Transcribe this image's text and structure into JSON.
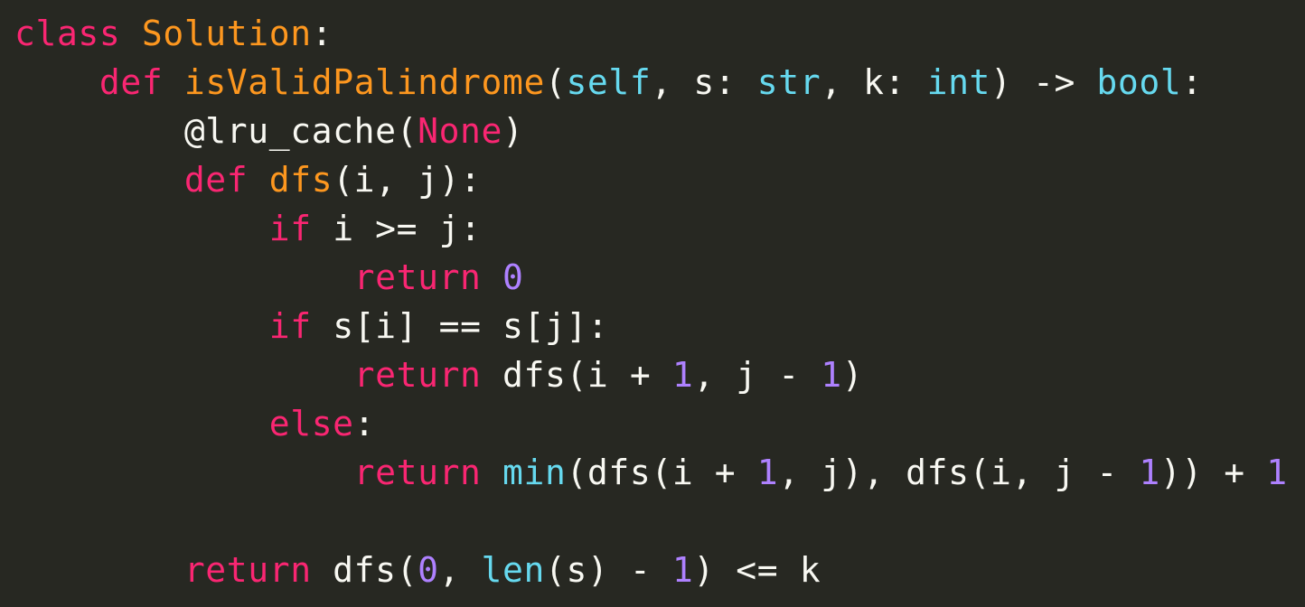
{
  "colors": {
    "background": "#272822",
    "keyword": "#f92672",
    "name": "#fd971f",
    "builtin": "#66d9ef",
    "number": "#ae81ff",
    "plain": "#f8f8f2"
  },
  "code": {
    "language": "python",
    "lines": [
      [
        {
          "t": "class",
          "c": "keyword"
        },
        {
          "t": " ",
          "c": "plain"
        },
        {
          "t": "Solution",
          "c": "name"
        },
        {
          "t": ":",
          "c": "plain"
        }
      ],
      [
        {
          "t": "    ",
          "c": "plain"
        },
        {
          "t": "def",
          "c": "keyword"
        },
        {
          "t": " ",
          "c": "plain"
        },
        {
          "t": "isValidPalindrome",
          "c": "name"
        },
        {
          "t": "(",
          "c": "plain"
        },
        {
          "t": "self",
          "c": "builtin"
        },
        {
          "t": ", s: ",
          "c": "plain"
        },
        {
          "t": "str",
          "c": "builtin"
        },
        {
          "t": ", k: ",
          "c": "plain"
        },
        {
          "t": "int",
          "c": "builtin"
        },
        {
          "t": ") -> ",
          "c": "plain"
        },
        {
          "t": "bool",
          "c": "builtin"
        },
        {
          "t": ":",
          "c": "plain"
        }
      ],
      [
        {
          "t": "        ",
          "c": "plain"
        },
        {
          "t": "@lru_cache(",
          "c": "plain"
        },
        {
          "t": "None",
          "c": "keyword"
        },
        {
          "t": ")",
          "c": "plain"
        }
      ],
      [
        {
          "t": "        ",
          "c": "plain"
        },
        {
          "t": "def",
          "c": "keyword"
        },
        {
          "t": " ",
          "c": "plain"
        },
        {
          "t": "dfs",
          "c": "name"
        },
        {
          "t": "(i, j):",
          "c": "plain"
        }
      ],
      [
        {
          "t": "            ",
          "c": "plain"
        },
        {
          "t": "if",
          "c": "keyword"
        },
        {
          "t": " i >= j:",
          "c": "plain"
        }
      ],
      [
        {
          "t": "                ",
          "c": "plain"
        },
        {
          "t": "return",
          "c": "keyword"
        },
        {
          "t": " ",
          "c": "plain"
        },
        {
          "t": "0",
          "c": "number"
        }
      ],
      [
        {
          "t": "            ",
          "c": "plain"
        },
        {
          "t": "if",
          "c": "keyword"
        },
        {
          "t": " s[i] == s[j]:",
          "c": "plain"
        }
      ],
      [
        {
          "t": "                ",
          "c": "plain"
        },
        {
          "t": "return",
          "c": "keyword"
        },
        {
          "t": " dfs(i + ",
          "c": "plain"
        },
        {
          "t": "1",
          "c": "number"
        },
        {
          "t": ", j - ",
          "c": "plain"
        },
        {
          "t": "1",
          "c": "number"
        },
        {
          "t": ")",
          "c": "plain"
        }
      ],
      [
        {
          "t": "            ",
          "c": "plain"
        },
        {
          "t": "else",
          "c": "keyword"
        },
        {
          "t": ":",
          "c": "plain"
        }
      ],
      [
        {
          "t": "                ",
          "c": "plain"
        },
        {
          "t": "return",
          "c": "keyword"
        },
        {
          "t": " ",
          "c": "plain"
        },
        {
          "t": "min",
          "c": "builtin"
        },
        {
          "t": "(dfs(i + ",
          "c": "plain"
        },
        {
          "t": "1",
          "c": "number"
        },
        {
          "t": ", j), dfs(i, j - ",
          "c": "plain"
        },
        {
          "t": "1",
          "c": "number"
        },
        {
          "t": ")) + ",
          "c": "plain"
        },
        {
          "t": "1",
          "c": "number"
        }
      ],
      [],
      [
        {
          "t": "        ",
          "c": "plain"
        },
        {
          "t": "return",
          "c": "keyword"
        },
        {
          "t": " dfs(",
          "c": "plain"
        },
        {
          "t": "0",
          "c": "number"
        },
        {
          "t": ", ",
          "c": "plain"
        },
        {
          "t": "len",
          "c": "builtin"
        },
        {
          "t": "(s) - ",
          "c": "plain"
        },
        {
          "t": "1",
          "c": "number"
        },
        {
          "t": ") <= k",
          "c": "plain"
        }
      ]
    ]
  }
}
